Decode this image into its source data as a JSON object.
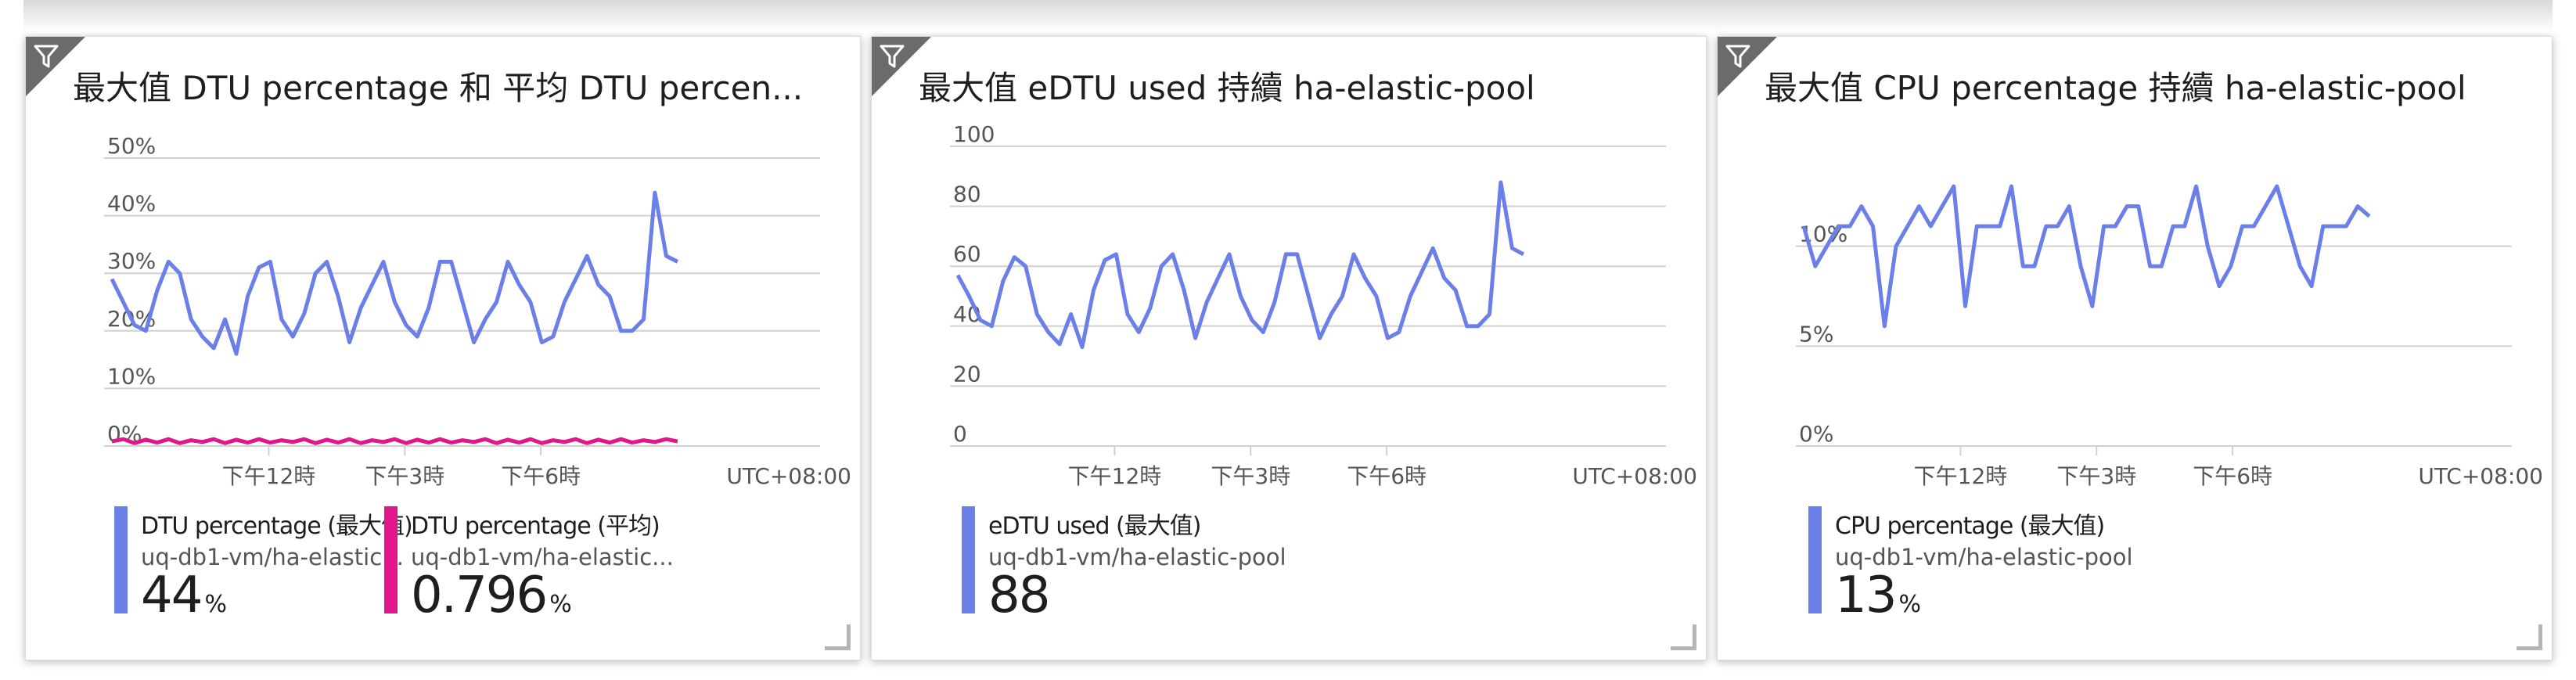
{
  "colors": {
    "blue": "#6b7fe8",
    "magenta": "#e0168a",
    "grid": "#d0d0d0"
  },
  "tiles": [
    {
      "title": "最大值 DTU percentage 和 平均 DTU percen...",
      "filter_icon": "funnel-icon",
      "timezone": "UTC+08:00",
      "legend": [
        {
          "series": "DTU percentage (最大值)",
          "resource": "uq-db1-vm/ha-elastic...",
          "value": "44",
          "unit": "%",
          "color": "#6b7fe8"
        },
        {
          "series": "DTU percentage (平均)",
          "resource": "uq-db1-vm/ha-elastic...",
          "value": "0.796",
          "unit": "%",
          "color": "#e0168a"
        }
      ]
    },
    {
      "title": "最大值 eDTU used 持續 ha-elastic-pool",
      "filter_icon": "funnel-icon",
      "timezone": "UTC+08:00",
      "legend": [
        {
          "series": "eDTU used (最大值)",
          "resource": "uq-db1-vm/ha-elastic-pool",
          "value": "88",
          "unit": "",
          "color": "#6b7fe8"
        }
      ]
    },
    {
      "title": "最大值 CPU percentage 持續 ha-elastic-pool",
      "filter_icon": "funnel-icon",
      "timezone": "UTC+08:00",
      "legend": [
        {
          "series": "CPU percentage (最大值)",
          "resource": "uq-db1-vm/ha-elastic-pool",
          "value": "13",
          "unit": "%",
          "color": "#6b7fe8"
        }
      ]
    }
  ],
  "chart_data": [
    {
      "type": "line",
      "title": "最大值 DTU percentage 和 平均 DTU percen...",
      "ylim": [
        0,
        50
      ],
      "yticks": [
        "0%",
        "10%",
        "20%",
        "30%",
        "40%",
        "50%"
      ],
      "ytick_values": [
        0,
        10,
        20,
        30,
        40,
        50
      ],
      "xticks": [
        "下午12時",
        "下午3時",
        "下午6時"
      ],
      "xtick_positions": [
        0.23,
        0.42,
        0.61
      ],
      "timezone": "UTC+08:00",
      "series": [
        {
          "name": "DTU percentage (最大值)",
          "color": "#6b7fe8",
          "values": [
            29,
            25,
            21,
            20,
            27,
            32,
            30,
            22,
            19,
            17,
            22,
            16,
            26,
            31,
            32,
            22,
            19,
            23,
            30,
            32,
            26,
            18,
            24,
            28,
            32,
            25,
            21,
            19,
            24,
            32,
            32,
            25,
            18,
            22,
            25,
            32,
            28,
            25,
            18,
            19,
            25,
            29,
            33,
            28,
            26,
            20,
            20,
            22,
            44,
            33,
            32
          ]
        },
        {
          "name": "DTU percentage (平均)",
          "color": "#e0168a",
          "values": [
            0.8,
            1.2,
            0.5,
            1.1,
            0.6,
            1.2,
            0.5,
            1.0,
            0.7,
            1.2,
            0.5,
            1.1,
            0.6,
            1.2,
            0.6,
            1.0,
            0.7,
            1.2,
            0.5,
            1.1,
            0.6,
            1.2,
            0.5,
            1.0,
            0.7,
            1.2,
            0.5,
            1.1,
            0.6,
            1.2,
            0.6,
            1.0,
            0.7,
            1.2,
            0.5,
            1.1,
            0.6,
            1.2,
            0.5,
            1.0,
            0.7,
            1.2,
            0.5,
            1.1,
            0.6,
            1.2,
            0.6,
            1.0,
            0.7,
            1.2,
            0.8
          ]
        }
      ]
    },
    {
      "type": "line",
      "title": "最大值 eDTU used 持續 ha-elastic-pool",
      "ylim": [
        0,
        100
      ],
      "yticks": [
        "0",
        "20",
        "40",
        "60",
        "80",
        "100"
      ],
      "ytick_values": [
        0,
        20,
        40,
        60,
        80,
        100
      ],
      "xticks": [
        "下午12時",
        "下午3時",
        "下午6時"
      ],
      "xtick_positions": [
        0.23,
        0.42,
        0.61
      ],
      "timezone": "UTC+08:00",
      "series": [
        {
          "name": "eDTU used (最大值)",
          "color": "#6b7fe8",
          "values": [
            57,
            50,
            42,
            40,
            55,
            63,
            60,
            44,
            38,
            34,
            44,
            33,
            52,
            62,
            64,
            44,
            38,
            46,
            60,
            64,
            52,
            36,
            48,
            56,
            64,
            50,
            42,
            38,
            48,
            64,
            64,
            50,
            36,
            44,
            50,
            64,
            56,
            50,
            36,
            38,
            50,
            58,
            66,
            56,
            52,
            40,
            40,
            44,
            88,
            66,
            64
          ]
        }
      ]
    },
    {
      "type": "line",
      "title": "最大值 CPU percentage 持續 ha-elastic-pool",
      "ylim": [
        0,
        15
      ],
      "yticks": [
        "0%",
        "5%",
        "10%"
      ],
      "ytick_values": [
        0,
        5,
        10
      ],
      "xticks": [
        "下午12時",
        "下午3時",
        "下午6時"
      ],
      "xtick_positions": [
        0.23,
        0.42,
        0.61
      ],
      "timezone": "UTC+08:00",
      "series": [
        {
          "name": "CPU percentage (最大值)",
          "color": "#6b7fe8",
          "values": [
            11,
            9,
            10,
            11,
            11,
            12,
            11,
            6,
            10,
            11,
            12,
            11,
            12,
            13,
            7,
            11,
            11,
            11,
            13,
            9,
            9,
            11,
            11,
            12,
            9,
            7,
            11,
            11,
            12,
            12,
            9,
            9,
            11,
            11,
            13,
            10,
            8,
            9,
            11,
            11,
            12,
            13,
            11,
            9,
            8,
            11,
            11,
            11,
            12,
            11.5
          ]
        }
      ]
    }
  ]
}
